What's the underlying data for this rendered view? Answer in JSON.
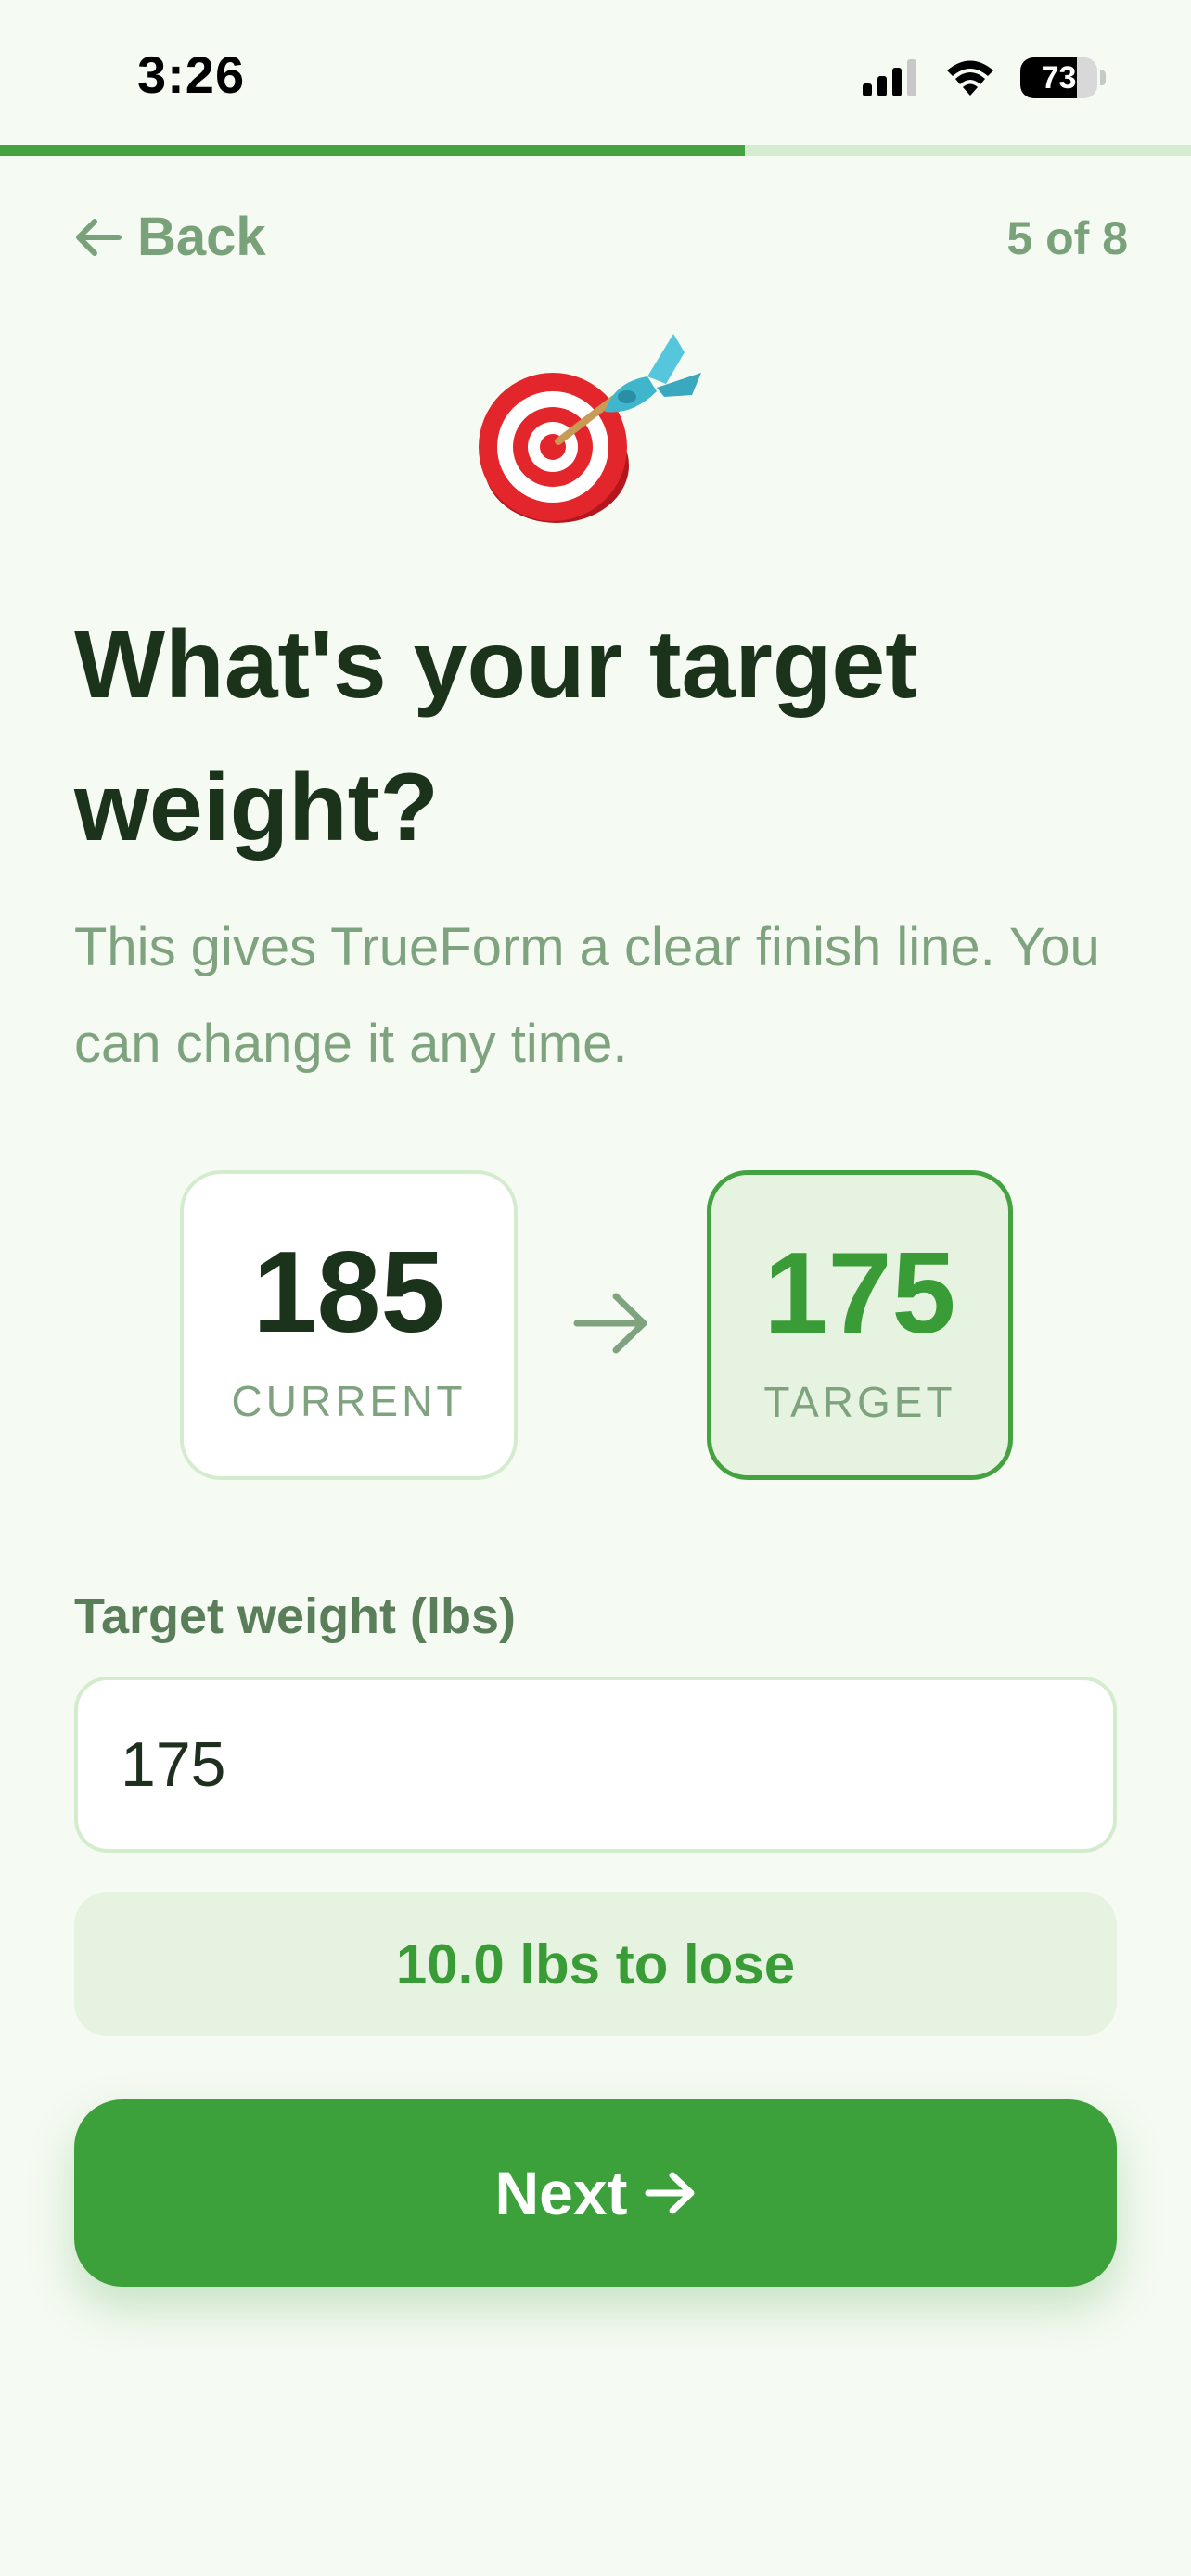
{
  "status_bar": {
    "time": "3:26",
    "battery_level": "73",
    "icons": [
      "cellular-signal-icon",
      "wifi-icon",
      "battery-icon"
    ]
  },
  "progress": {
    "fraction": 0.625
  },
  "nav": {
    "back_label": "Back",
    "step_counter": "5 of 8"
  },
  "hero": {
    "icon": "target-dart-icon"
  },
  "question": {
    "title": "What's your target weight?",
    "subtitle": "This gives TrueForm a clear finish line. You can change it any time."
  },
  "comparison": {
    "current": {
      "value": "185",
      "label": "CURRENT"
    },
    "target": {
      "value": "175",
      "label": "TARGET"
    },
    "arrow_icon": "arrow-right-icon"
  },
  "form": {
    "label": "Target weight (lbs)",
    "value": "175",
    "placeholder": ""
  },
  "summary": {
    "text": "10.0 lbs to lose"
  },
  "actions": {
    "next_label": "Next"
  },
  "colors": {
    "accent": "#3ca13a",
    "background": "#f5faf2",
    "muted_text": "#7fa37f",
    "heading": "#1a331a"
  }
}
